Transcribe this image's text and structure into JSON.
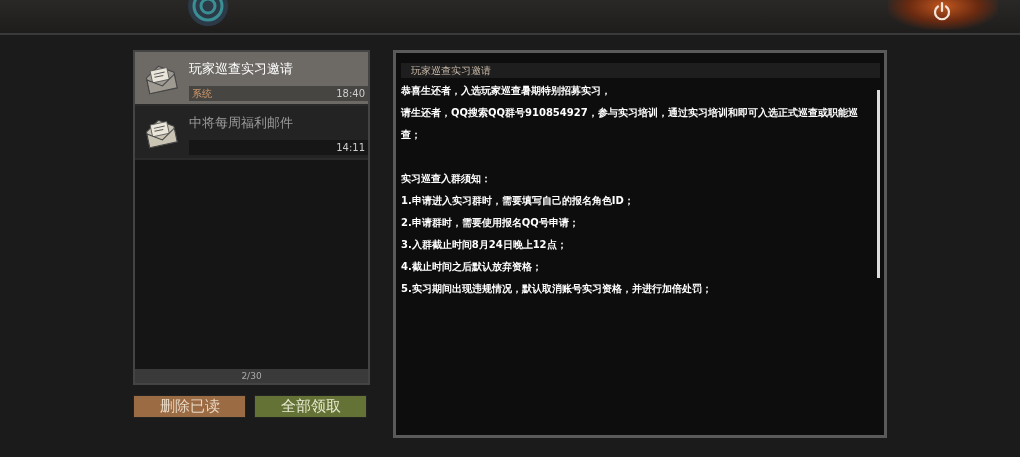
{
  "mails": [
    {
      "title": "玩家巡查实习邀请",
      "sender": "系统",
      "time": "18:40",
      "selected": true
    },
    {
      "title": "中将每周福利邮件",
      "time": "14:11",
      "selected": false
    }
  ],
  "pager": "2/30",
  "buttons": [
    {
      "label": "删除已读",
      "kind": "delete"
    },
    {
      "label": "全部领取",
      "kind": "claim"
    }
  ],
  "message": {
    "title": "玩家巡查实习邀请",
    "paragraphs": [
      [
        "恭喜生还者，入选玩家巡查暑期特别招募实习，",
        "请生还者，QQ搜索QQ群号910854927，参与实习培训，通过实习培训和即可入选正式巡查或职能巡查；"
      ],
      [
        "实习巡查入群须知：",
        "1.申请进入实习群时，需要填写自己的报名角色ID；",
        "2.申请群时，需要使用报名QQ号申请；",
        "3.入群截止时间8月24日晚上12点；",
        "4.截止时间之后默认放弃资格；",
        "5.实习期间出现违规情况，默认取消账号实习资格，并进行加倍处罚；"
      ]
    ]
  }
}
